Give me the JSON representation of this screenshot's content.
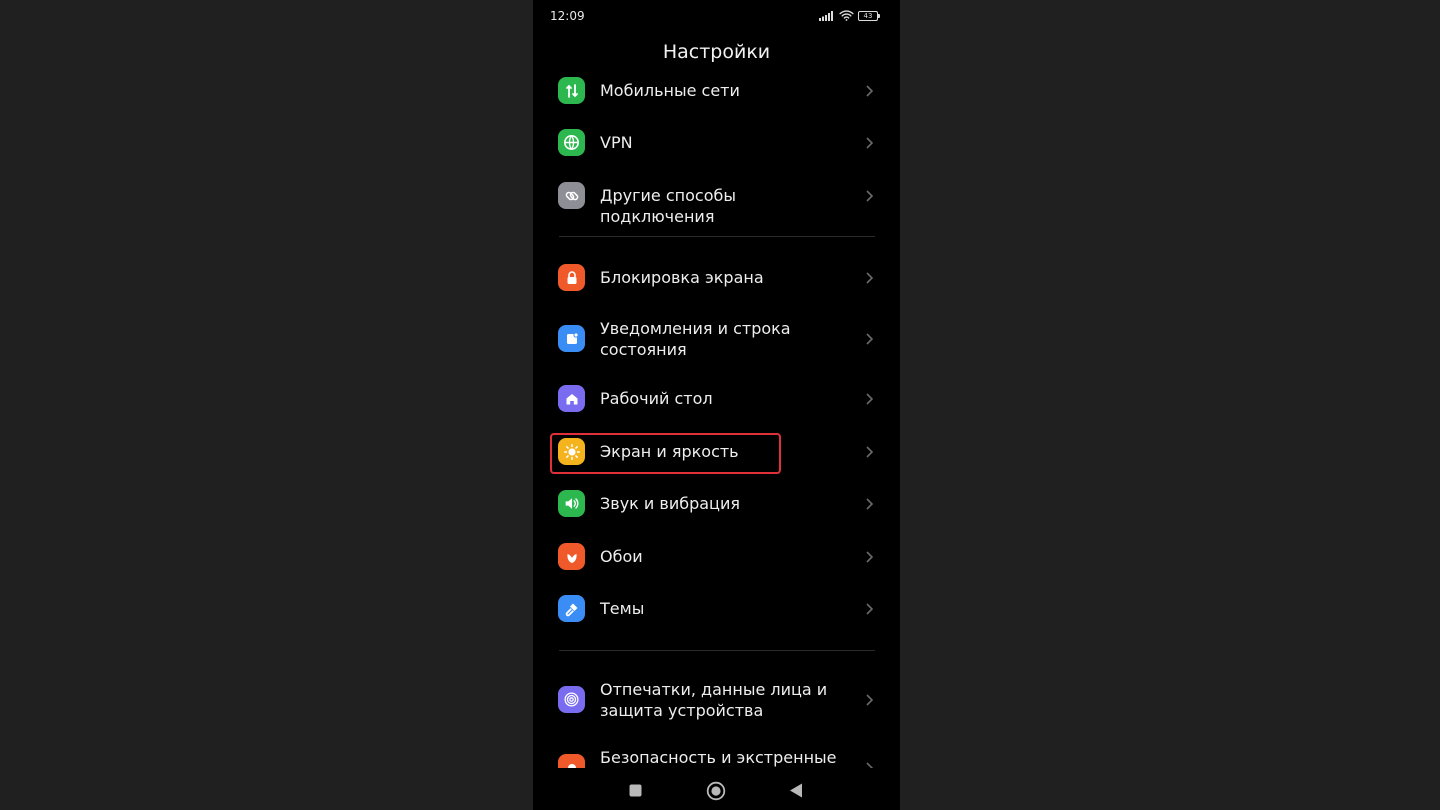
{
  "status": {
    "time": "12:09",
    "battery": "43"
  },
  "header": {
    "title": "Настройки"
  },
  "items": [
    {
      "label": "Мобильные сети",
      "icon": "mobile-networks-icon",
      "color": "#2cb84f"
    },
    {
      "label": "VPN",
      "icon": "globe-icon",
      "color": "#2cb84f"
    },
    {
      "label": "Другие способы подключения",
      "icon": "link-icon",
      "color": "#8e8e96"
    },
    {
      "label": "Блокировка экрана",
      "icon": "lock-icon",
      "color": "#f05a2a"
    },
    {
      "label": "Уведомления и строка состояния",
      "icon": "notification-icon",
      "color": "#3a8df5"
    },
    {
      "label": "Рабочий стол",
      "icon": "home-icon",
      "color": "#7a6cf0"
    },
    {
      "label": "Экран и яркость",
      "icon": "sun-icon",
      "color": "#f5b41e"
    },
    {
      "label": "Звук и вибрация",
      "icon": "speaker-icon",
      "color": "#2cb84f"
    },
    {
      "label": "Обои",
      "icon": "wallpaper-icon",
      "color": "#f05a2a"
    },
    {
      "label": "Темы",
      "icon": "brush-icon",
      "color": "#3a8df5"
    },
    {
      "label": "Отпечатки, данные лица и защита устройства",
      "icon": "fingerprint-icon",
      "color": "#7a6cf0"
    },
    {
      "label": "Безопасность и экстренные",
      "icon": "emergency-icon",
      "color": "#f05a2a"
    }
  ],
  "accent": {
    "highlight": "#e0313a"
  }
}
